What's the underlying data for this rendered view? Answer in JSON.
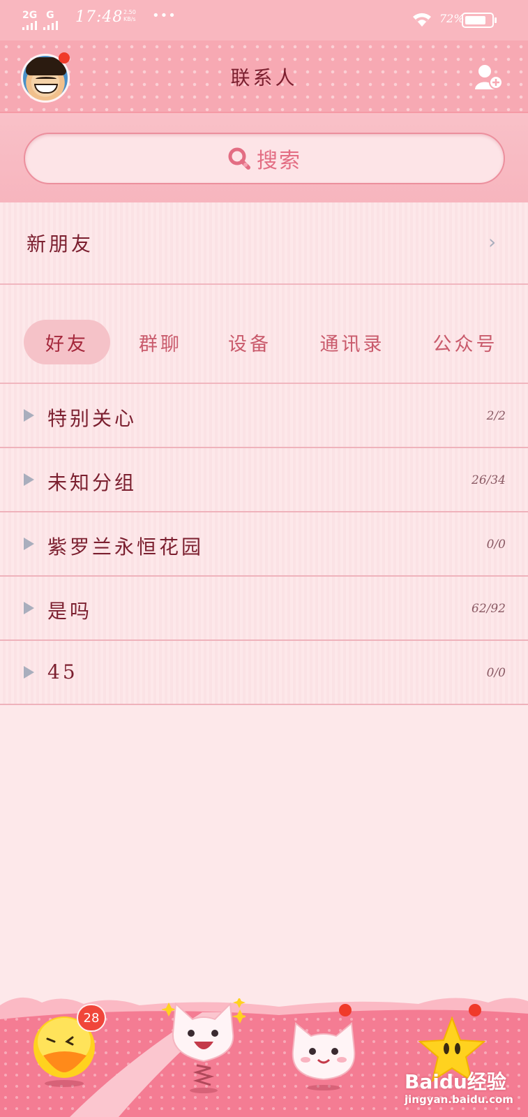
{
  "status_bar": {
    "network_1": "2G",
    "network_2": "G",
    "time": "17:48",
    "speed_value": "2.50",
    "speed_unit": "KB/s",
    "more": "•••",
    "battery_percent": "72%"
  },
  "header": {
    "title": "联系人"
  },
  "search": {
    "label": "搜索"
  },
  "new_friends": {
    "label": "新朋友"
  },
  "tabs": [
    {
      "label": "好友",
      "active": true
    },
    {
      "label": "群聊",
      "active": false
    },
    {
      "label": "设备",
      "active": false
    },
    {
      "label": "通讯录",
      "active": false
    },
    {
      "label": "公众号",
      "active": false
    }
  ],
  "groups": [
    {
      "name": "特别关心",
      "count": "2/2"
    },
    {
      "name": "未知分组",
      "count": "26/34"
    },
    {
      "name": "紫罗兰永恒花园",
      "count": "0/0"
    },
    {
      "name": "是吗",
      "count": "62/92"
    },
    {
      "name": "45",
      "count": "0/0"
    }
  ],
  "bottom_nav": {
    "messages_badge": "28"
  },
  "watermark": {
    "main": "Baidu经验",
    "sub": "jingyan.baidu.com"
  }
}
